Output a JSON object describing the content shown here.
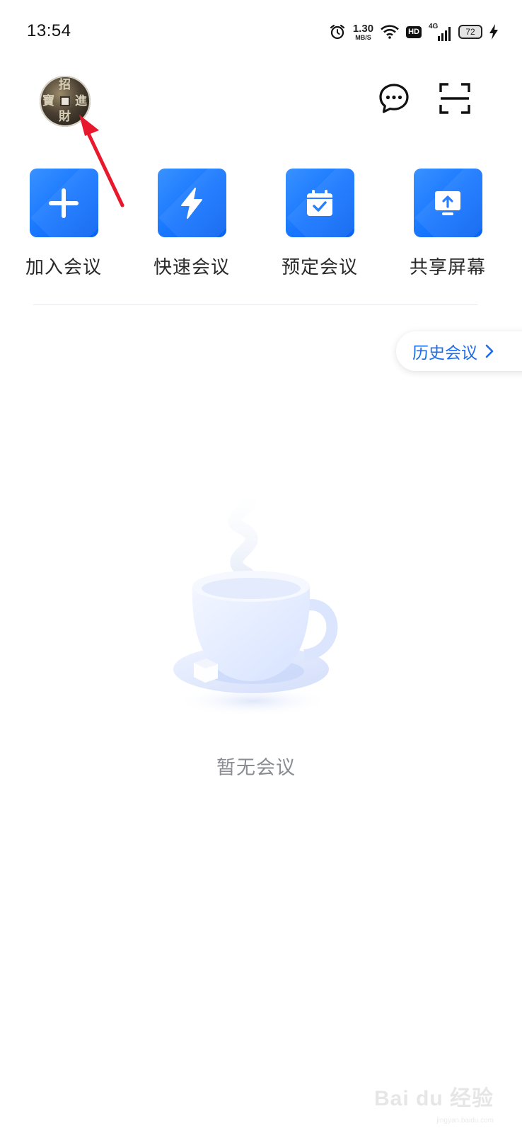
{
  "status_bar": {
    "time": "13:54",
    "net_speed_value": "1.30",
    "net_speed_unit": "MB/S",
    "hd": "HD",
    "network": "4G",
    "battery": "72",
    "icons": [
      "alarm-icon",
      "wifi-icon",
      "signal-icon",
      "charging-icon"
    ]
  },
  "header": {
    "avatar_chars": [
      "招",
      "財",
      "寶",
      "進"
    ],
    "icons": [
      "message-icon",
      "scan-icon"
    ]
  },
  "actions": [
    {
      "label": "加入会议",
      "icon": "plus-icon"
    },
    {
      "label": "快速会议",
      "icon": "lightning-icon"
    },
    {
      "label": "预定会议",
      "icon": "calendar-check-icon"
    },
    {
      "label": "共享屏幕",
      "icon": "share-screen-icon"
    }
  ],
  "history": {
    "label": "历史会议"
  },
  "empty_state": {
    "text": "暂无会议",
    "illustration": "tea-cup-illustration"
  },
  "watermark": {
    "text": "Bai du 经验",
    "sub": "jingyan.baidu.com"
  },
  "colors": {
    "accent": "#1877ff",
    "link": "#1a6cf0",
    "annotation_arrow": "#e8192c"
  }
}
